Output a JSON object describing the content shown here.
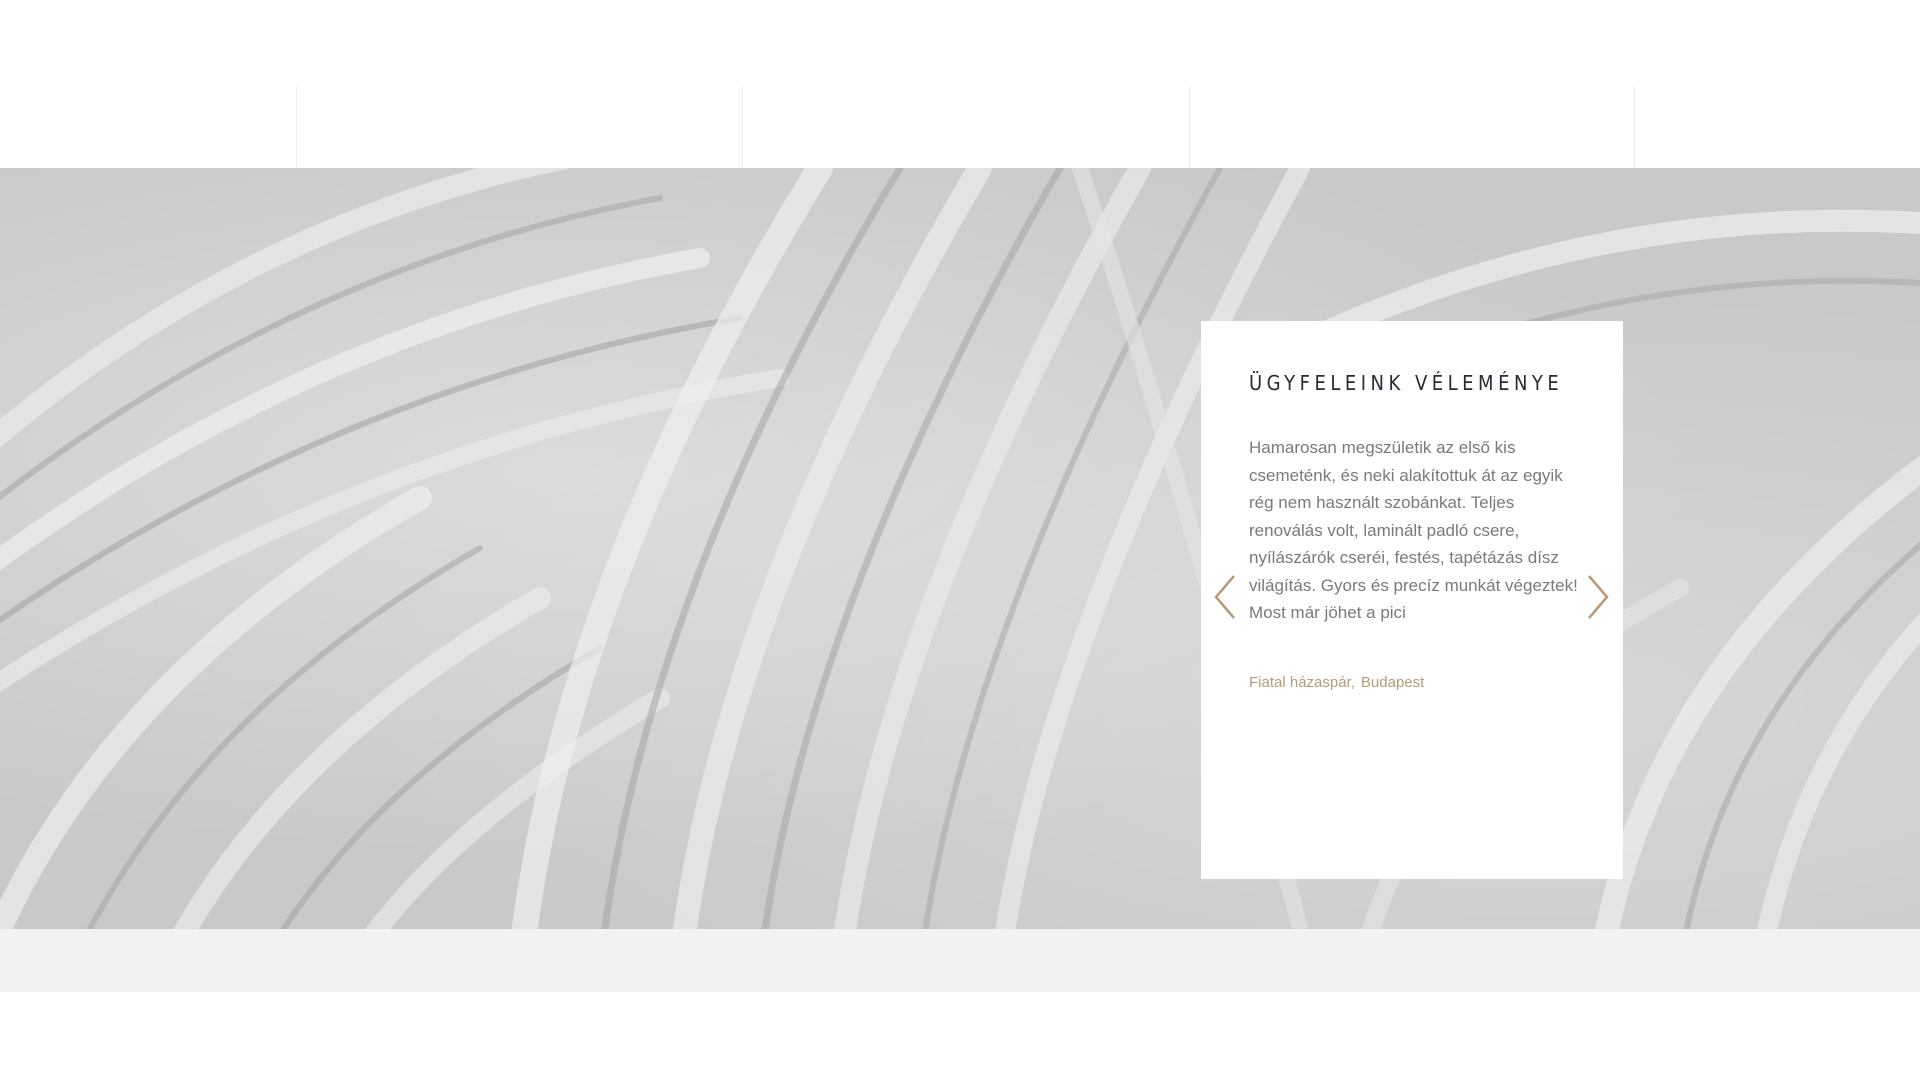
{
  "testimonials": {
    "title": "ÜGYFELEINK VÉLEMÉNYE",
    "quote": "Hamarosan megszületik az első kis csemeténk, és neki alakítottuk át az egyik rég nem használt szobánkat. Teljes renoválás volt, laminált padló csere, nyílászárók cseréi, festés, tapétázás dísz világítás. Gyors és precíz munkát végeztek!  Most már jöhet a pici",
    "author_name": "Fiatal házaspár,",
    "author_city": "Budapest",
    "prev_icon": "chevron-left-icon",
    "next_icon": "chevron-right-icon"
  },
  "colors": {
    "accent": "#b89a78",
    "title": "#2b2b33",
    "text": "#7a7a7a",
    "band": "#f2f2f2"
  }
}
